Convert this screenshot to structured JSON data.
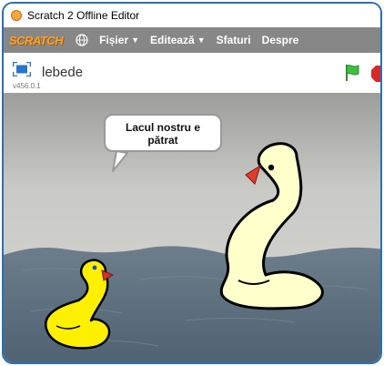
{
  "window": {
    "title": "Scratch 2 Offline Editor"
  },
  "menubar": {
    "logo": "SCRATCH",
    "items": [
      {
        "label": "Fișier",
        "has_caret": true
      },
      {
        "label": "Editează",
        "has_caret": true
      },
      {
        "label": "Sfaturi",
        "has_caret": false
      },
      {
        "label": "Despre",
        "has_caret": false
      }
    ]
  },
  "stage_header": {
    "project_title": "lebede",
    "version": "v456.0.1"
  },
  "speech_bubble": {
    "text": "Lacul nostru e pătrat"
  },
  "icons": {
    "app": "scratch-cat-icon",
    "language": "globe-icon",
    "presentation": "presentation-mode-icon",
    "start": "green-flag-icon",
    "stop": "stop-sign-icon"
  },
  "colors": {
    "menu_bg": "#878787",
    "logo": "#f7a233",
    "green_flag": "#3ec03e",
    "stop": "#d42a2a",
    "window_border": "#2c6fb3",
    "small_swan": "#ffef00",
    "big_swan": "#ffffcc",
    "water": "#5f7384",
    "wall": "#c8c8c4"
  }
}
